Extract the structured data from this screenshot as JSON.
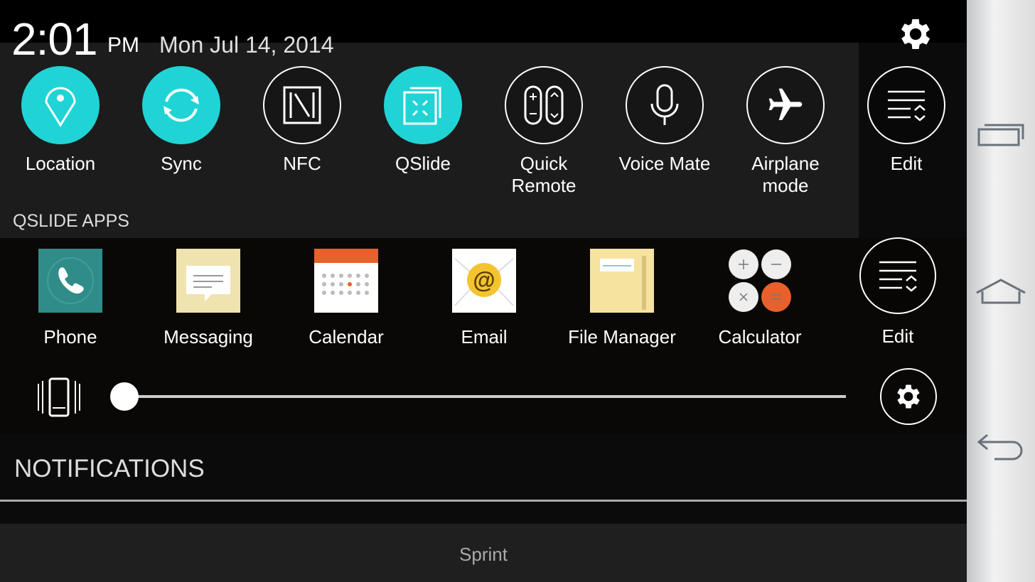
{
  "status": {
    "time": "2:01",
    "ampm": "PM",
    "date": "Mon Jul 14, 2014",
    "settings_icon": "gear-icon"
  },
  "accent": "#20d4d6",
  "quick_settings": [
    {
      "label": "Location",
      "icon": "location-pin-icon",
      "on": true
    },
    {
      "label": "Sync",
      "icon": "sync-icon",
      "on": true
    },
    {
      "label": "NFC",
      "icon": "nfc-icon",
      "on": false
    },
    {
      "label": "QSlide",
      "icon": "qslide-icon",
      "on": true
    },
    {
      "label": "Quick Remote",
      "icon": "remote-icon",
      "on": false
    },
    {
      "label": "Voice Mate",
      "icon": "microphone-icon",
      "on": false
    },
    {
      "label": "Airplane mode",
      "icon": "airplane-icon",
      "on": false
    },
    {
      "label": "Edit",
      "icon": "edit-list-icon",
      "on": false
    }
  ],
  "qslide_apps": {
    "title": "QSLIDE APPS",
    "items": [
      {
        "label": "Phone",
        "icon": "phone-icon"
      },
      {
        "label": "Messaging",
        "icon": "messaging-icon"
      },
      {
        "label": "Calendar",
        "icon": "calendar-icon"
      },
      {
        "label": "Email",
        "icon": "email-icon"
      },
      {
        "label": "File Manager",
        "icon": "folder-icon"
      },
      {
        "label": "Calculator",
        "icon": "calculator-icon"
      }
    ],
    "edit_label": "Edit"
  },
  "volume": {
    "mode_icon": "vibrate-icon",
    "level": 0,
    "settings_icon": "gear-icon"
  },
  "notifications": {
    "title": "NOTIFICATIONS"
  },
  "carrier": "Sprint",
  "navbar": [
    "recent-apps-icon",
    "home-icon",
    "back-icon"
  ]
}
